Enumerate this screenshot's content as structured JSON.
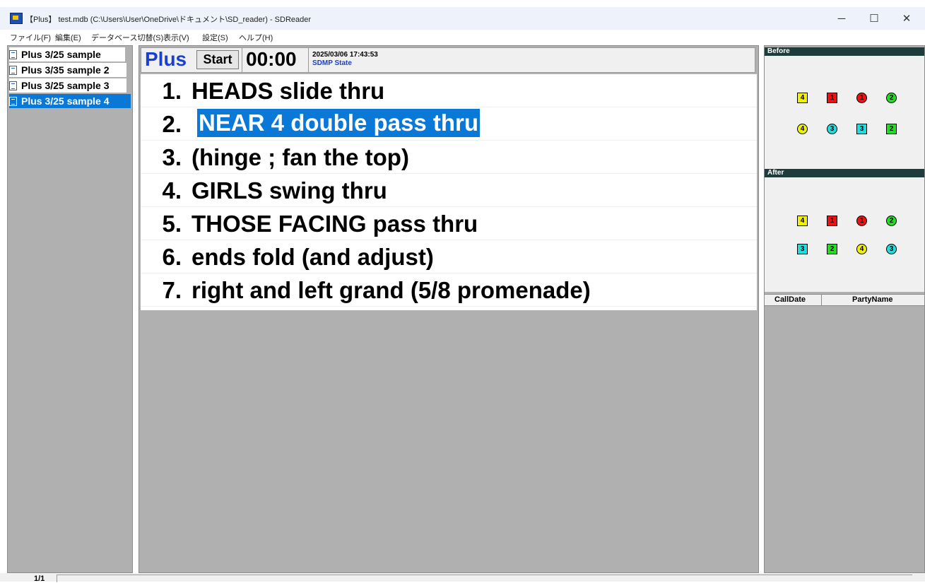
{
  "window": {
    "title": "【Plus】 test.mdb (C:\\Users\\User\\OneDrive\\ドキュメント\\SD_reader) - SDReader",
    "minimize": "─",
    "maximize": "☐",
    "close": "✕"
  },
  "menu": {
    "file": "ファイル(F)",
    "edit": "編集(E)",
    "database": "データベース切替(S)",
    "view": "表示(V)",
    "settings": "設定(S)",
    "help": "ヘルプ(H)"
  },
  "sequences": [
    {
      "label": "Plus 3/25 sample"
    },
    {
      "label": "Plus 3/35 sample 2"
    },
    {
      "label": "Plus 3/25 sample 3"
    },
    {
      "label": "Plus 3/25 sample 4",
      "selected": true
    }
  ],
  "header": {
    "level": "Plus",
    "start_label": "Start",
    "timer": "00:00",
    "datetime": "2025/03/06 17:43:53",
    "state": "SDMP State"
  },
  "calls": [
    {
      "num": "1.",
      "text": "HEADS slide thru"
    },
    {
      "num": "2.",
      "text": "NEAR 4 double pass thru",
      "highlighted": true
    },
    {
      "num": "3.",
      "text": "(hinge ; fan the top)"
    },
    {
      "num": "4.",
      "text": "GIRLS swing thru"
    },
    {
      "num": "5.",
      "text": "THOSE FACING pass thru"
    },
    {
      "num": "6.",
      "text": "ends fold (and adjust)"
    },
    {
      "num": "7.",
      "text": "right and left grand  (5/8 promenade)"
    }
  ],
  "before": {
    "title": "Before",
    "row1": [
      {
        "label": "4",
        "shape": "square",
        "color": "#f2f200"
      },
      {
        "label": "1",
        "shape": "square",
        "color": "#ee1111"
      },
      {
        "label": "1",
        "shape": "circle",
        "color": "#ee1111"
      },
      {
        "label": "2",
        "shape": "circle",
        "color": "#22dd22"
      }
    ],
    "row2": [
      {
        "label": "4",
        "shape": "circle",
        "color": "#f2f200"
      },
      {
        "label": "3",
        "shape": "circle",
        "color": "#22dddd"
      },
      {
        "label": "3",
        "shape": "square",
        "color": "#22dddd"
      },
      {
        "label": "2",
        "shape": "square",
        "color": "#22dd22"
      }
    ]
  },
  "after": {
    "title": "After",
    "row1": [
      {
        "label": "4",
        "shape": "square",
        "color": "#f2f200"
      },
      {
        "label": "1",
        "shape": "square",
        "color": "#ee1111"
      },
      {
        "label": "1",
        "shape": "circle",
        "color": "#ee1111"
      },
      {
        "label": "2",
        "shape": "circle",
        "color": "#22dd22"
      }
    ],
    "row2": [
      {
        "label": "3",
        "shape": "square",
        "color": "#22dddd"
      },
      {
        "label": "2",
        "shape": "square",
        "color": "#22dd22"
      },
      {
        "label": "4",
        "shape": "circle",
        "color": "#f2f200"
      },
      {
        "label": "3",
        "shape": "circle",
        "color": "#22dddd"
      }
    ]
  },
  "grid": {
    "col_calldate": "CallDate",
    "col_partyname": "PartyName"
  },
  "status": {
    "page": "1/1"
  },
  "colors": {
    "selection": "#0a78d7",
    "level_text": "#1a3fd1",
    "panel_header": "#1c3d3b"
  }
}
